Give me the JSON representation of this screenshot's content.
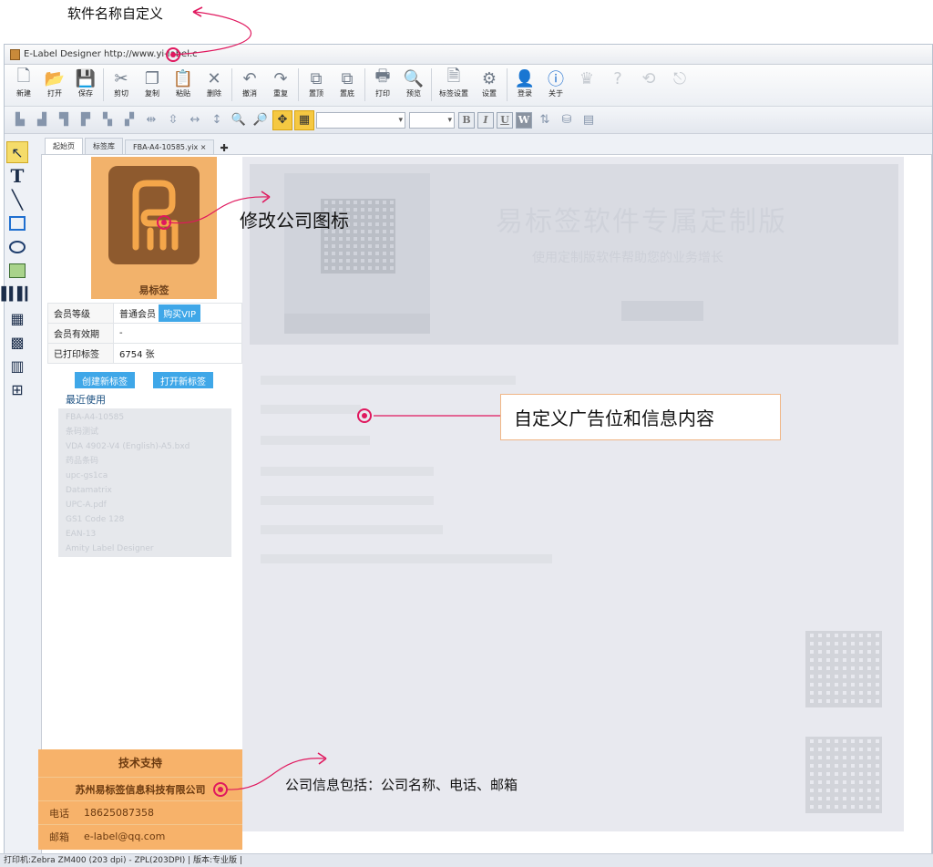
{
  "annotations": {
    "name_custom": "软件名称自定义",
    "change_logo": "修改公司图标",
    "ad_info": "自定义广告位和信息内容",
    "company_info": "公司信息包括：公司名称、电话、邮箱"
  },
  "window": {
    "title": "E-Label Designer http://www.yi-label.c"
  },
  "toolbar": {
    "buttons": [
      "新建",
      "打开",
      "保存",
      "剪切",
      "复制",
      "粘贴",
      "删除",
      "撤消",
      "重复",
      "置顶",
      "置底",
      "打印",
      "预览",
      "标签设置",
      "设置",
      "登录",
      "关于"
    ]
  },
  "tabs": [
    "起始页",
    "标签库",
    "FBA-A4-10585.yix ×"
  ],
  "logo": {
    "name": "易标签"
  },
  "member": {
    "level_label": "会员等级",
    "level_value": "普通会员",
    "vip_button": "购买VIP",
    "validity_label": "会员有效期",
    "validity_value": "-",
    "printed_label": "已打印标签",
    "printed_value": "6754 张"
  },
  "actions": {
    "create": "创建新标签",
    "open": "打开新标签"
  },
  "recent": {
    "title": "最近使用",
    "items": [
      "FBA-A4-10585",
      "条码测试",
      "VDA 4902-V4 (English)-A5.bxd",
      "药品条码",
      "upc-gs1ca",
      "Datamatrix",
      "UPC-A.pdf",
      "GS1 Code 128",
      "EAN-13",
      "Amity Label Designer"
    ]
  },
  "support": {
    "title": "技术支持",
    "company": "苏州易标签信息科技有限公司",
    "phone_label": "电话",
    "phone": "18625087358",
    "email_label": "邮箱",
    "email": "e-label@qq.com"
  },
  "banner": {
    "headline": "易标签软件专属定制版",
    "subline": "使用定制版软件帮助您的业务增长"
  },
  "statusbar": {
    "text": "打印机:Zebra ZM400 (203 dpi) - ZPL(203DPI)  |  版本:专业版  |"
  },
  "colors": {
    "accent": "#e0185e",
    "orange": "#f7b26a",
    "blue": "#3fa7e8"
  }
}
